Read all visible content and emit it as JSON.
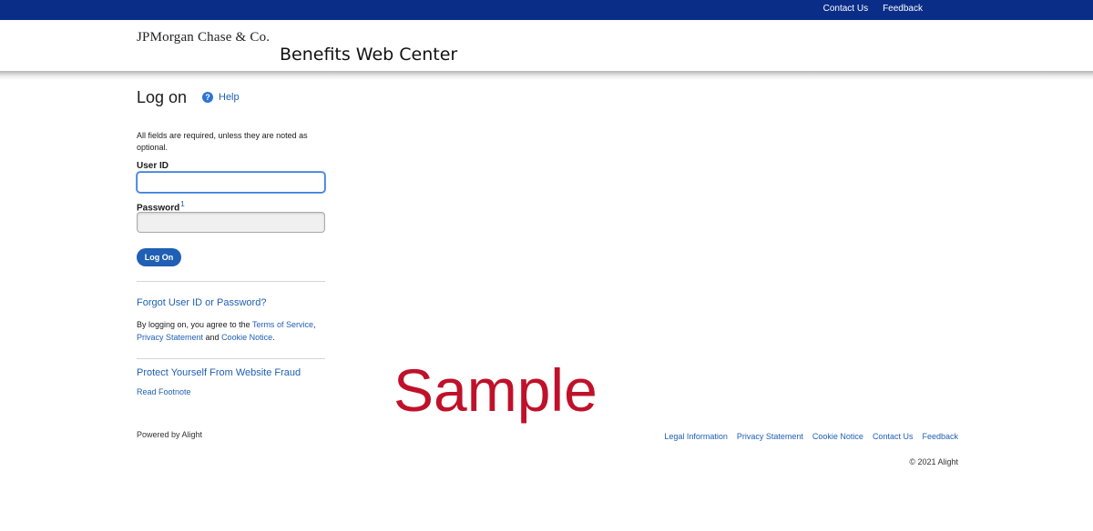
{
  "topbar": {
    "links": [
      "Contact Us",
      "Feedback"
    ]
  },
  "header": {
    "brand": "JPMorgan Chase & Co.",
    "app_title": "Benefits Web Center"
  },
  "logon": {
    "title": "Log on",
    "help_label": "Help",
    "help_icon": "?",
    "required_note": "All fields are required, unless they are noted as optional.",
    "user_id_label": "User ID",
    "user_id_value": "",
    "password_label": "Password",
    "password_footnote": "1",
    "password_value": "",
    "logon_button": "Log On",
    "forgot_link": "Forgot User ID or Password?",
    "agree_prefix": "By logging on, you agree to the ",
    "terms_link": "Terms of Service",
    "agree_comma": ",",
    "privacy_link": "Privacy Statement",
    "agree_and": " and ",
    "cookie_link": "Cookie Notice",
    "agree_end": ".",
    "protect_link": "Protect Yourself From Website Fraud",
    "footnote_link": "Read Footnote",
    "powered_by": "Powered by Alight"
  },
  "watermark": "Sample",
  "footer": {
    "links": [
      "Legal Information",
      "Privacy Statement",
      "Cookie Notice",
      "Contact Us",
      "Feedback"
    ],
    "copyright": "© 2021 Alight"
  },
  "colors": {
    "topbar": "#0a2d88",
    "link": "#1f5fb4",
    "button": "#1f5fb4",
    "watermark": "#c0112a"
  }
}
